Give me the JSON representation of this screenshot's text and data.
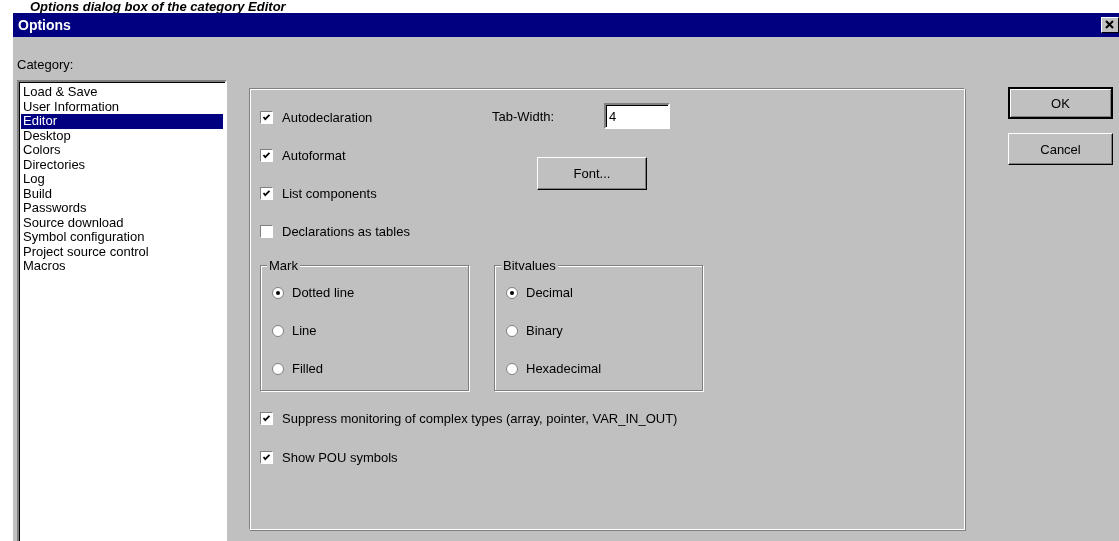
{
  "caption": "Options dialog box of the category Editor",
  "window": {
    "title": "Options"
  },
  "category": {
    "label": "Category:",
    "items": [
      {
        "label": "Load & Save",
        "selected": false
      },
      {
        "label": "User Information",
        "selected": false
      },
      {
        "label": "Editor",
        "selected": true
      },
      {
        "label": "Desktop",
        "selected": false
      },
      {
        "label": "Colors",
        "selected": false
      },
      {
        "label": "Directories",
        "selected": false
      },
      {
        "label": "Log",
        "selected": false
      },
      {
        "label": "Build",
        "selected": false
      },
      {
        "label": "Passwords",
        "selected": false
      },
      {
        "label": "Source download",
        "selected": false
      },
      {
        "label": "Symbol configuration",
        "selected": false
      },
      {
        "label": "Project source control",
        "selected": false
      },
      {
        "label": "Macros",
        "selected": false
      }
    ]
  },
  "editor": {
    "checkboxes": [
      {
        "label": "Autodeclaration",
        "checked": true
      },
      {
        "label": "Autoformat",
        "checked": true
      },
      {
        "label": "List components",
        "checked": true
      },
      {
        "label": "Declarations as tables",
        "checked": false
      }
    ],
    "tab_width": {
      "label": "Tab-Width:",
      "value": "4"
    },
    "font_button": "Font...",
    "groups": [
      {
        "title": "Mark",
        "options": [
          {
            "label": "Dotted line",
            "selected": true
          },
          {
            "label": "Line",
            "selected": false
          },
          {
            "label": "Filled",
            "selected": false
          }
        ]
      },
      {
        "title": "Bitvalues",
        "options": [
          {
            "label": "Decimal",
            "selected": true
          },
          {
            "label": "Binary",
            "selected": false
          },
          {
            "label": "Hexadecimal",
            "selected": false
          }
        ]
      }
    ],
    "more_checkboxes": [
      {
        "label": "Suppress monitoring of complex types (array, pointer, VAR_IN_OUT)",
        "checked": true
      },
      {
        "label": "Show POU symbols",
        "checked": true
      }
    ]
  },
  "buttons": [
    {
      "label": "OK",
      "default": true
    },
    {
      "label": "Cancel",
      "default": false
    }
  ]
}
